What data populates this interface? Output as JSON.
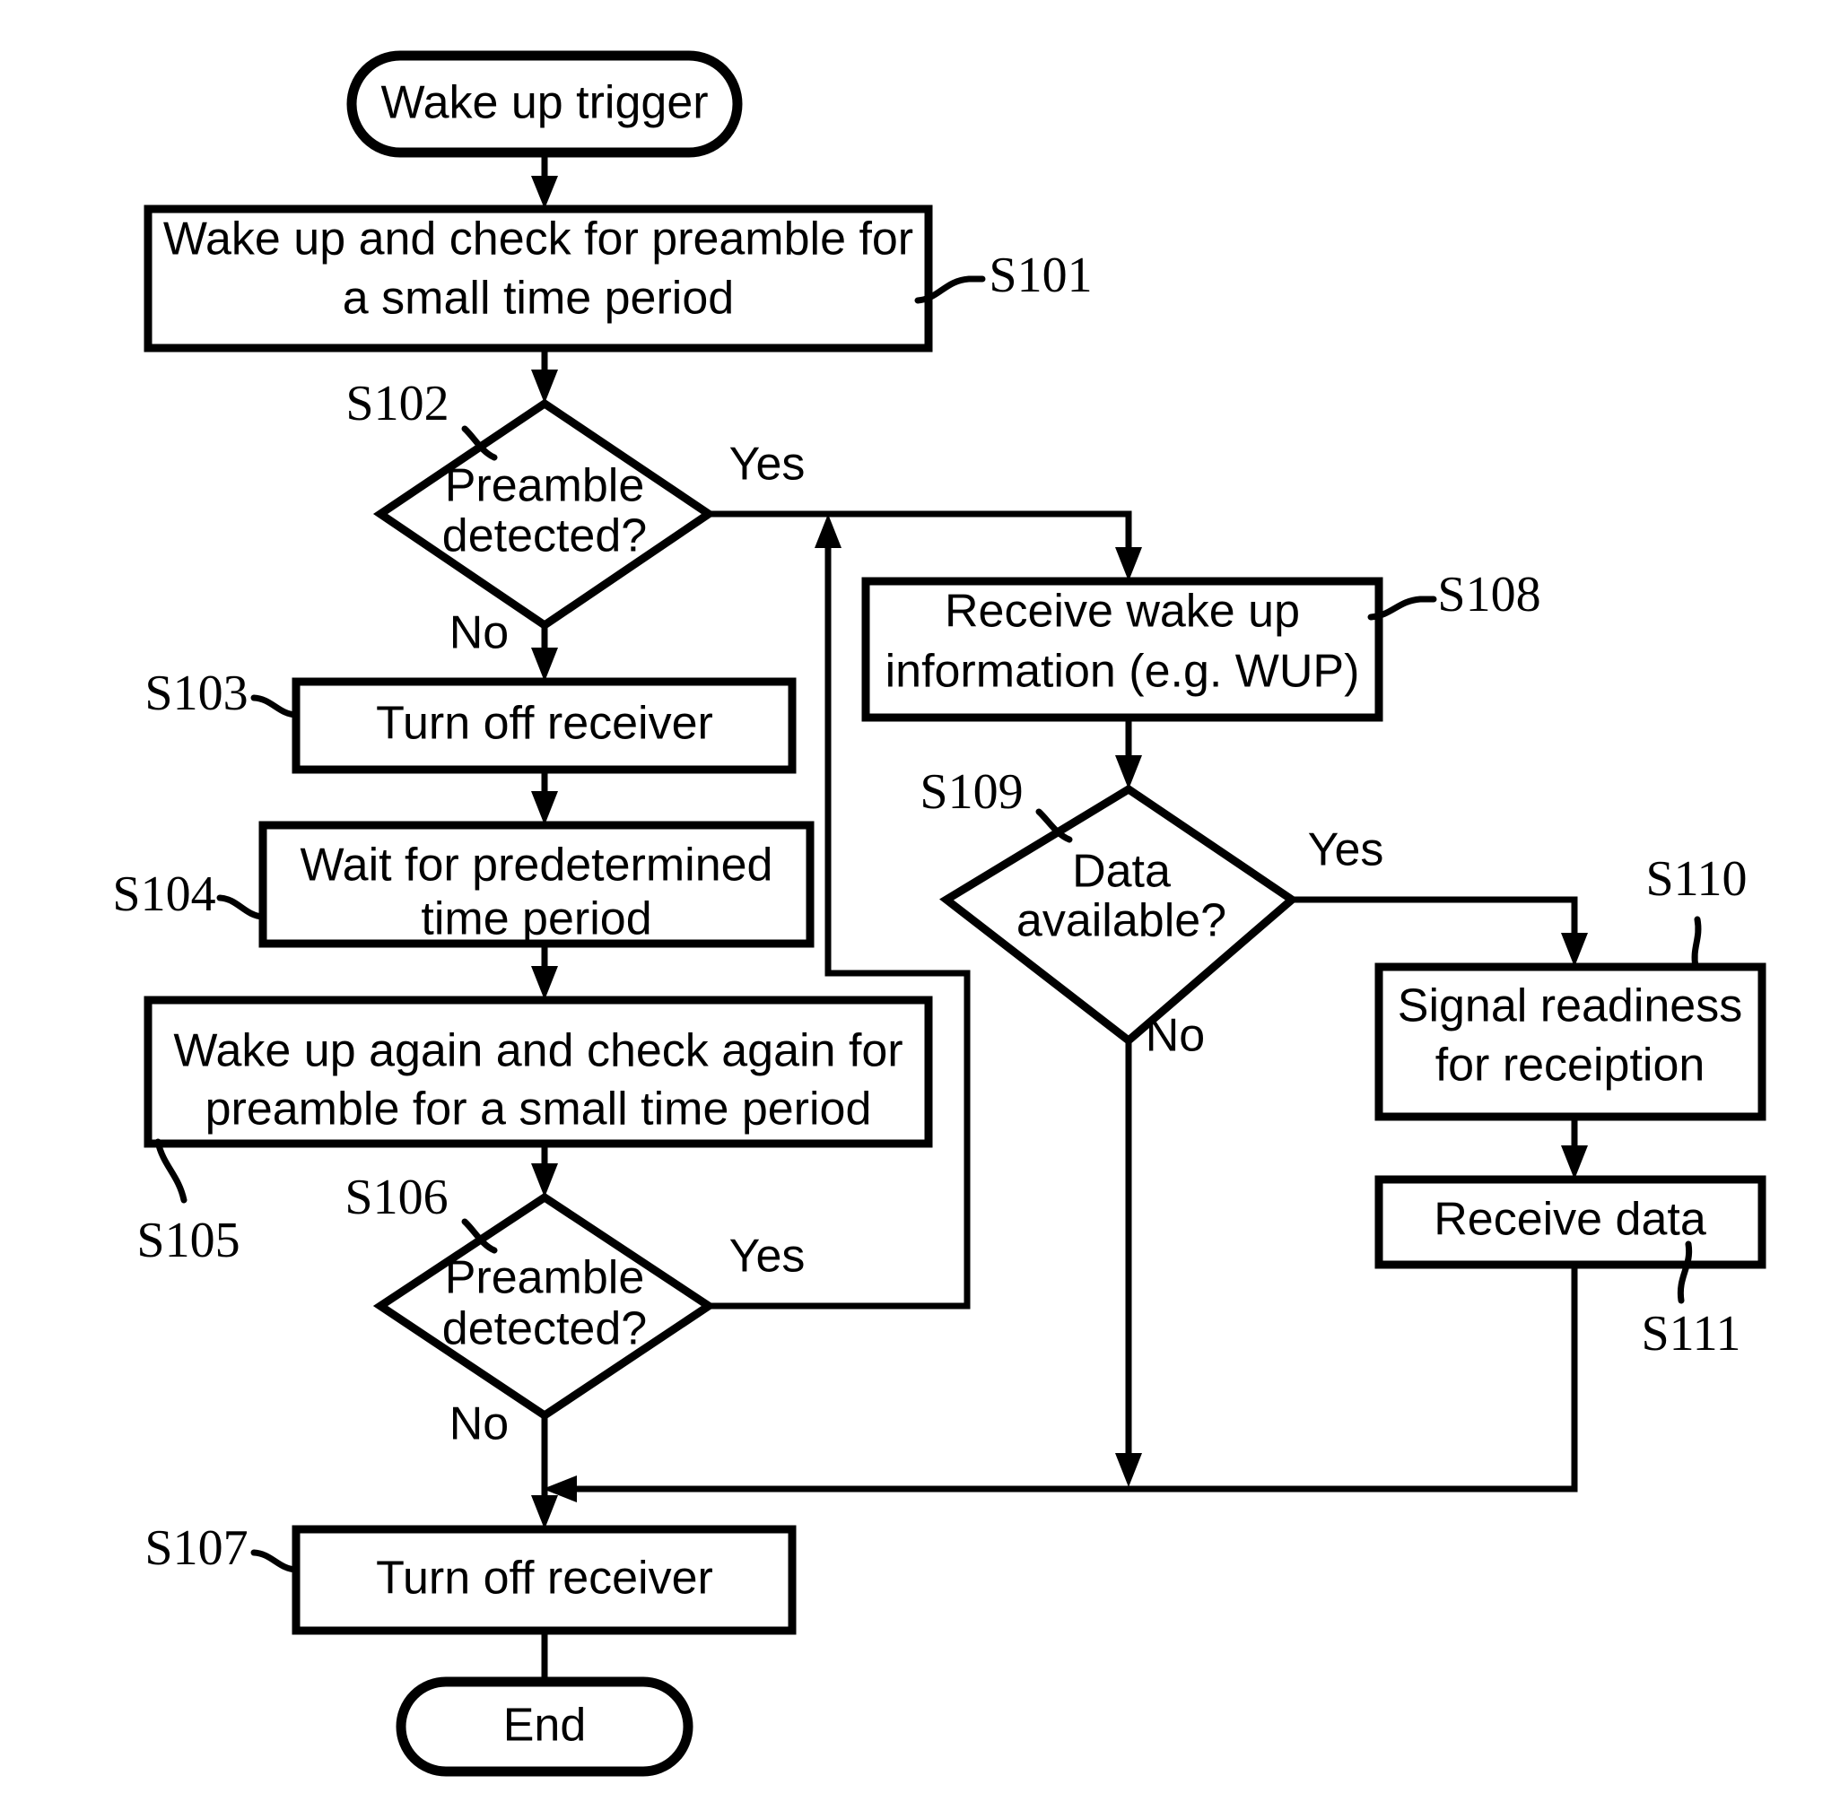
{
  "diagram": {
    "type": "flowchart",
    "title": "Wake up receiver preamble detection flowchart",
    "nodes": {
      "start": {
        "ref": "",
        "shape": "terminator",
        "label": "Wake up trigger"
      },
      "s101": {
        "ref": "S101",
        "shape": "process",
        "line1": "Wake up and check for preamble for",
        "line2": "a small time period"
      },
      "s102": {
        "ref": "S102",
        "shape": "decision",
        "line1": "Preamble",
        "line2": "detected?"
      },
      "s103": {
        "ref": "S103",
        "shape": "process",
        "line1": "Turn off receiver",
        "line2": ""
      },
      "s104": {
        "ref": "S104",
        "shape": "process",
        "line1": "Wait for predetermined",
        "line2": "time period"
      },
      "s105": {
        "ref": "S105",
        "shape": "process",
        "line1": "Wake up again and check again for",
        "line2": "preamble for a small time period"
      },
      "s106": {
        "ref": "S106",
        "shape": "decision",
        "line1": "Preamble",
        "line2": "detected?"
      },
      "s107": {
        "ref": "S107",
        "shape": "process",
        "line1": "Turn off receiver",
        "line2": ""
      },
      "s108": {
        "ref": "S108",
        "shape": "process",
        "line1": "Receive wake up",
        "line2": "information (e.g. WUP)"
      },
      "s109": {
        "ref": "S109",
        "shape": "decision",
        "line1": "Data",
        "line2": "available?"
      },
      "s110": {
        "ref": "S110",
        "shape": "process",
        "line1": "Signal readiness",
        "line2": "for receiption"
      },
      "s111": {
        "ref": "S111",
        "shape": "process",
        "line1": "Receive data",
        "line2": ""
      },
      "end": {
        "ref": "",
        "shape": "terminator",
        "label": "End"
      }
    },
    "branch_labels": {
      "s102_yes": "Yes",
      "s102_no": "No",
      "s106_yes": "Yes",
      "s106_no": "No",
      "s109_yes": "Yes",
      "s109_no": "No"
    },
    "colors": {
      "stroke": "#000000",
      "fill": "#ffffff",
      "background": "#ffffff"
    }
  }
}
